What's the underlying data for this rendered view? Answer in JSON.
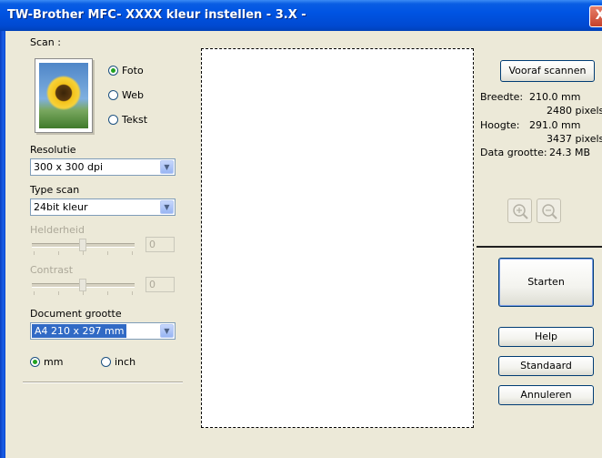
{
  "window": {
    "title": "TW-Brother MFC- XXXX kleur instellen - 3.X -",
    "close_glyph": "X"
  },
  "scan": {
    "label": "Scan :",
    "options": [
      {
        "label": "Foto",
        "selected": true
      },
      {
        "label": "Web",
        "selected": false
      },
      {
        "label": "Tekst",
        "selected": false
      }
    ]
  },
  "resolution": {
    "label": "Resolutie",
    "value": "300 x 300 dpi"
  },
  "scan_type": {
    "label": "Type scan",
    "value": "24bit kleur"
  },
  "brightness": {
    "label": "Helderheid",
    "value": "0",
    "enabled": false
  },
  "contrast": {
    "label": "Contrast",
    "value": "0",
    "enabled": false
  },
  "document_size": {
    "label": "Document grootte",
    "value": "A4 210 x 297 mm"
  },
  "units": [
    {
      "label": "mm",
      "selected": true
    },
    {
      "label": "inch",
      "selected": false
    }
  ],
  "prescan_button": "Vooraf scannen",
  "info": {
    "width_label": "Breedte:",
    "width_mm": "210.0 mm",
    "width_px": "2480 pixels",
    "height_label": "Hoogte:",
    "height_mm": "291.0 mm",
    "height_px": "3437 pixels",
    "size_label": "Data grootte:",
    "size_value": "24.3 MB"
  },
  "zoom": {
    "in_icon": "zoom-in-icon",
    "out_icon": "zoom-out-icon"
  },
  "buttons": {
    "start": "Starten",
    "help": "Help",
    "default": "Standaard",
    "cancel": "Annuleren"
  },
  "colors": {
    "titlebar": "#0054e3",
    "dialog_bg": "#ece9d8",
    "selection": "#316ac5",
    "radio_dot": "#21a121"
  }
}
